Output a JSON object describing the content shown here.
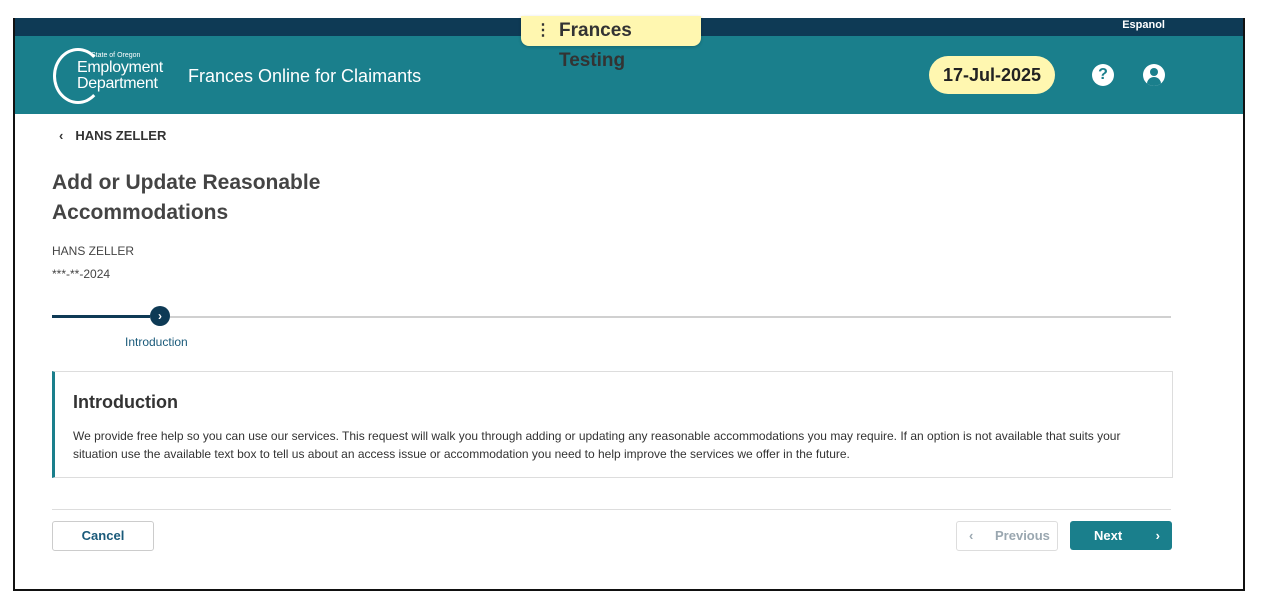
{
  "topbar": {
    "language_link": "Espanol"
  },
  "testing_tab": {
    "menu_glyph": "⋮",
    "label": "Frances Testing"
  },
  "header": {
    "logo": {
      "state": "State of Oregon",
      "line1": "Employment",
      "line2": "Department"
    },
    "app_title": "Frances Online for Claimants",
    "date": "17-Jul-2025",
    "help_glyph": "?",
    "icons": [
      "help-icon",
      "user-account-icon"
    ],
    "colors": {
      "header_bg": "#1a7f8c",
      "top_strip": "#0e3a55",
      "date_pill": "#fff7b0"
    }
  },
  "breadcrumb": {
    "chevron": "‹",
    "label": "HANS ZELLER"
  },
  "page": {
    "title": "Add or Update Reasonable Accommodations",
    "claimant_name": "HANS ZELLER",
    "ssn_masked": "***-**-2024"
  },
  "stepper": {
    "current_step_label": "Introduction",
    "step_glyph": "›"
  },
  "intro": {
    "heading": "Introduction",
    "body": "We provide free help so you can use our services. This request will walk you through adding or updating any reasonable accommodations you may require. If an option is not available that suits your situation use the available text box to tell us about an access issue or accommodation you need to help improve the services we offer in the future."
  },
  "actions": {
    "cancel": "Cancel",
    "previous": "Previous",
    "previous_chevron": "‹",
    "next": "Next",
    "next_chevron": "›"
  }
}
